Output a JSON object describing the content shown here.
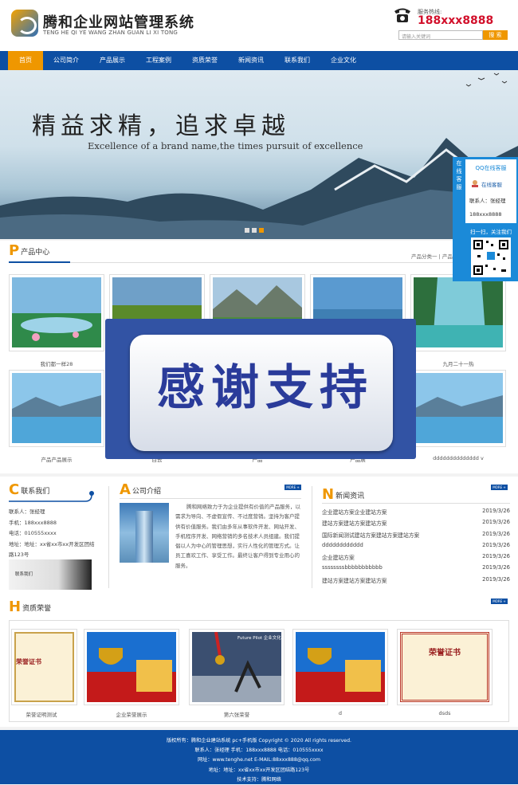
{
  "header": {
    "brand": "腾和企业网站管理系统",
    "brand_en": "TENG HE QI YE WANG ZHAN GUAN LI XI TONG",
    "hotline_label": "服务热线:",
    "hotline_number": "188xxx8888",
    "search_placeholder": "请输入关键词",
    "search_button": "搜 索"
  },
  "nav": [
    "首页",
    "公司简介",
    "产品展示",
    "工程案例",
    "资质荣誉",
    "新闻资讯",
    "联系我们",
    "企业文化"
  ],
  "banner": {
    "title": "精益求精，追求卓越",
    "subtitle": "Excellence of a brand name,the times pursuit of excellence"
  },
  "products": {
    "letter": "P",
    "title": "产品中心",
    "categories": "产品分类一 | 产品分类",
    "row1": [
      "我们都一样28",
      "",
      "",
      "",
      "九月二十一热"
    ],
    "row2": [
      "产品产品展示",
      "白云",
      "产品",
      "产品展",
      "dddddddddddddd v"
    ]
  },
  "overlay": {
    "text": "感谢支持"
  },
  "contact": {
    "letter": "C",
    "title": "联系我们",
    "lines": [
      "联系人：张经理",
      "手机：188xxx8888",
      "电话：010555xxxx",
      "地址：地址：xx省xx市xx开发区团结",
      "路123号"
    ],
    "img_text": "联系我们"
  },
  "about": {
    "letter": "A",
    "title": "公司介绍",
    "more": "MORE +",
    "text": "腾和网络致力于为企业提供有价值的产品服务，以需求为导向、不虚假宣传、不过度营销。坚持为客户提供有价值服务。我们由多年从事软件开发、网站开发、手机程序开发、网络营销的多名技术人员组建。我们提倡以人为中心的管理思想，实行人性化的管理方式。让员工喜欢工作、享受工作。最终让客户得到专业用心的服务。"
  },
  "news": {
    "letter": "N",
    "title": "新闻资讯",
    "more": "MORE +",
    "items": [
      {
        "title": "企业建站方案企业建站方案",
        "date": "2019/3/26"
      },
      {
        "title": "建站方案建站方案建站方案",
        "date": "2019/3/26"
      },
      {
        "title": "国际新闻测试建站方案建站方案建站方案",
        "date": "2019/3/26"
      },
      {
        "title": "dddddddddddd",
        "date": "2019/3/26"
      },
      {
        "title": "企业建站方案",
        "date": "2019/3/26"
      },
      {
        "title": "ssssssssbbbbbbbbbbb",
        "date": "2019/3/26"
      },
      {
        "title": "建站方案建站方案建站方案",
        "date": "2019/3/26"
      }
    ]
  },
  "honors": {
    "letter": "H",
    "title": "资质荣誉",
    "more": "MORE +",
    "items": [
      "荣誉证明测试",
      "企业荣誉展示",
      "第六张荣誉",
      "d",
      "dsds"
    ],
    "cert_text": "荣誉证书",
    "cert_text2": "荣誉证书",
    "future_text": "Future Pilot 企业文化"
  },
  "footer": {
    "lines": [
      "版权所有：腾和企业建站系统 pc+手机版 Copyright © 2020 All rights reserved.",
      "联系人：张经理 手机：188xxx8888 电话：010555xxxx",
      "网址：www.tenghe.net E-MAIL:88xxx888@qq.com",
      "地址：地址：xx省xx市xx开发区团结路123号",
      "技术支持：腾和网络"
    ]
  },
  "qq": {
    "vertical": "在线客服",
    "title": "QQ在线客服",
    "online": "在线客服",
    "contact": "联系人：张经理",
    "phone": "188xxx8888",
    "scan": "扫一扫，关注我们"
  },
  "colors": {
    "nav_blue": "#0d4fa3",
    "accent_orange": "#ef9700",
    "hotline_red": "#d2102b"
  }
}
